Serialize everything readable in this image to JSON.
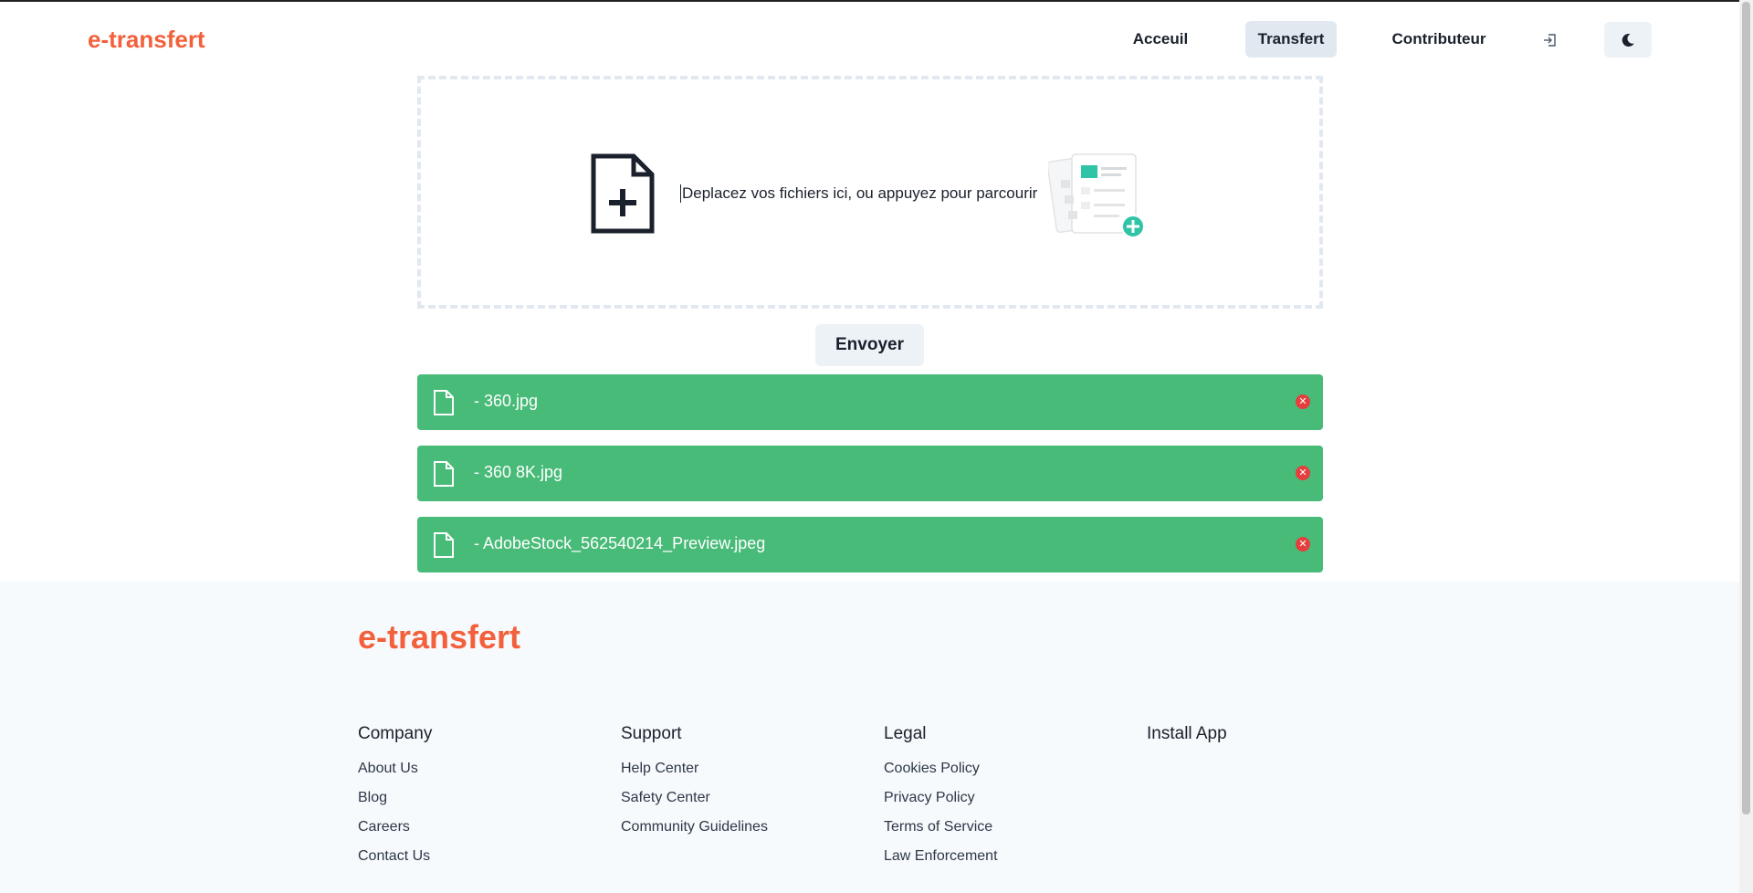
{
  "header": {
    "brand": "e-transfert",
    "nav": {
      "home": "Acceuil",
      "transfer": "Transfert",
      "contributor": "Contributeur"
    },
    "login_icon": "login-icon",
    "theme_icon": "moon-icon"
  },
  "dropzone": {
    "text": "Deplacez vos fichiers ici, ou appuyez pour parcourir",
    "icon": "file-plus-icon"
  },
  "send_label": "Envoyer",
  "files": [
    {
      "name": "- 360.jpg"
    },
    {
      "name": "- 360 8K.jpg"
    },
    {
      "name": "- AdobeStock_562540214_Preview.jpeg"
    }
  ],
  "colors": {
    "brand": "#f2603c",
    "file_row": "#48bb78",
    "remove": "#e53e3e"
  },
  "footer": {
    "brand": "e-transfert",
    "columns": [
      {
        "title": "Company",
        "links": [
          "About Us",
          "Blog",
          "Careers",
          "Contact Us"
        ]
      },
      {
        "title": "Support",
        "links": [
          "Help Center",
          "Safety Center",
          "Community Guidelines"
        ]
      },
      {
        "title": "Legal",
        "links": [
          "Cookies Policy",
          "Privacy Policy",
          "Terms of Service",
          "Law Enforcement"
        ]
      },
      {
        "title": "Install App",
        "links": []
      }
    ]
  }
}
